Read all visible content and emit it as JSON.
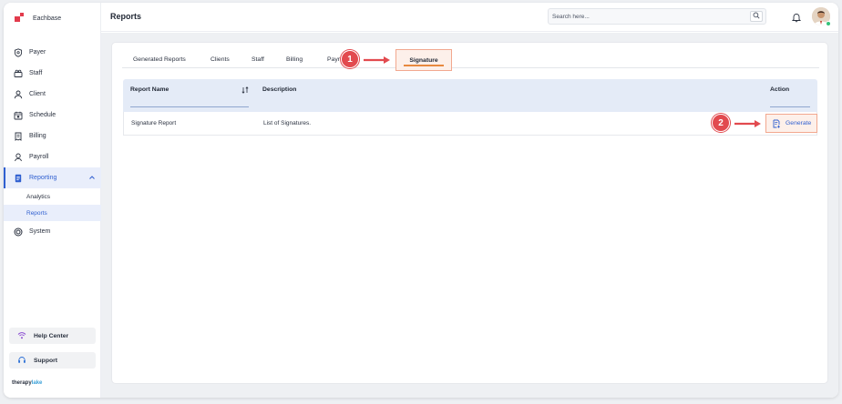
{
  "brand": {
    "name": "Eachbase"
  },
  "sidebar": {
    "items": [
      {
        "label": "Payer",
        "icon": "shield-icon"
      },
      {
        "label": "Staff",
        "icon": "staff-icon"
      },
      {
        "label": "Client",
        "icon": "client-icon"
      },
      {
        "label": "Schedule",
        "icon": "calendar-icon"
      },
      {
        "label": "Billing",
        "icon": "billing-icon"
      },
      {
        "label": "Payroll",
        "icon": "payroll-icon"
      },
      {
        "label": "Reporting",
        "icon": "report-icon"
      }
    ],
    "sub_items": [
      {
        "label": "Analytics"
      },
      {
        "label": "Reports"
      }
    ],
    "system": {
      "label": "System",
      "icon": "system-icon"
    },
    "help_center": "Help Center",
    "support": "Support",
    "footer_logo_a": "therapy",
    "footer_logo_b": "lake"
  },
  "header": {
    "title": "Reports",
    "search_placeholder": "Search here..."
  },
  "tabs": [
    {
      "label": "Generated Reports"
    },
    {
      "label": "Clients"
    },
    {
      "label": "Staff"
    },
    {
      "label": "Billing"
    },
    {
      "label": "Payr"
    },
    {
      "label": "Signature"
    }
  ],
  "table": {
    "headers": {
      "name": "Report Name",
      "description": "Description",
      "action": "Action"
    },
    "rows": [
      {
        "name": "Signature Report",
        "description": "List of Signatures.",
        "action": "Generate"
      }
    ]
  },
  "annotations": {
    "step1": "1",
    "step2": "2"
  },
  "colors": {
    "accent": "#2f5fd0",
    "brand_red": "#e23b4c",
    "highlight": "#fdf0ea",
    "highlight_border": "#f2a88f",
    "badge": "#e24a4f"
  }
}
